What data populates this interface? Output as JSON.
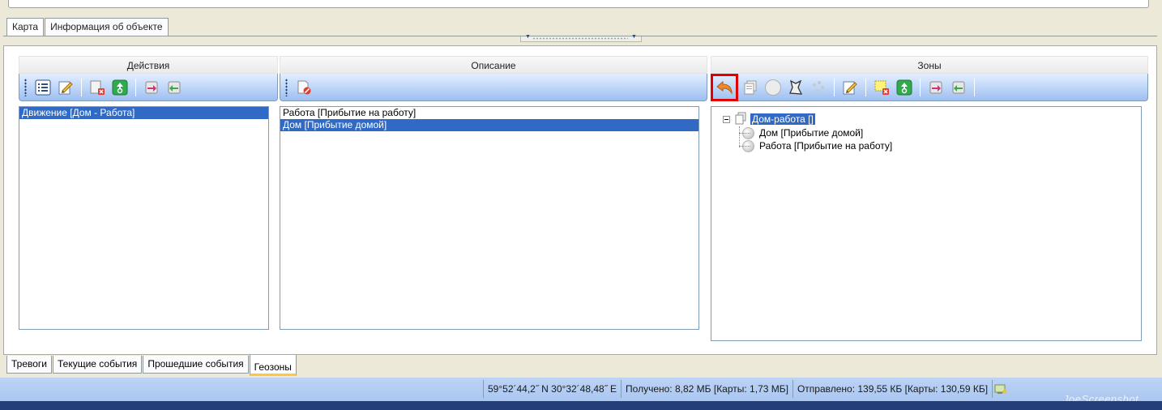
{
  "top_tabs": [
    "Карта",
    "Информация об объекте"
  ],
  "columns": {
    "actions": {
      "header": "Действия",
      "items": [
        {
          "label": "Движение [Дом - Работа]",
          "selected": true
        }
      ]
    },
    "description": {
      "header": "Описание",
      "items": [
        {
          "label": "Работа [Прибытие на работу]",
          "selected": false
        },
        {
          "label": "Дом [Прибытие домой]",
          "selected": true
        }
      ]
    },
    "zones": {
      "header": "Зоны",
      "tree": {
        "root": "Дом-работа []",
        "children": [
          "Дом [Прибытие домой]",
          "Работа [Прибытие на работу]"
        ]
      }
    }
  },
  "toolbars": {
    "actions": [
      "list-icon",
      "edit-icon",
      "delete-page-icon",
      "recycle-icon",
      "import-icon",
      "export-icon"
    ],
    "description": [
      "delete-document-icon"
    ],
    "zones": [
      "undo-icon",
      "copy-icon",
      "circle-icon",
      "polygon-icon",
      "points-icon",
      "edit-icon",
      "delete-zone-icon",
      "recycle-icon",
      "import-icon",
      "export-icon"
    ]
  },
  "bottom_tabs": [
    "Тревоги",
    "Текущие события",
    "Прошедшие события",
    "Геозоны"
  ],
  "bottom_active": "Геозоны",
  "status": {
    "coords": "59°52´44,2˝ N  30°32´48,48˝ E",
    "received": "Получено: 8,82 МБ [Карты: 1,73 МБ]",
    "sent": "Отправлено: 139,55 КБ [Карты: 130,59 КБ]"
  },
  "watermark": "JoeScreenshot",
  "colors": {
    "selection": "#316ac5",
    "highlight_border": "#e00000",
    "toolbar_gradient": "#9ebff0",
    "active_tab_accent": "#ffc83c"
  }
}
